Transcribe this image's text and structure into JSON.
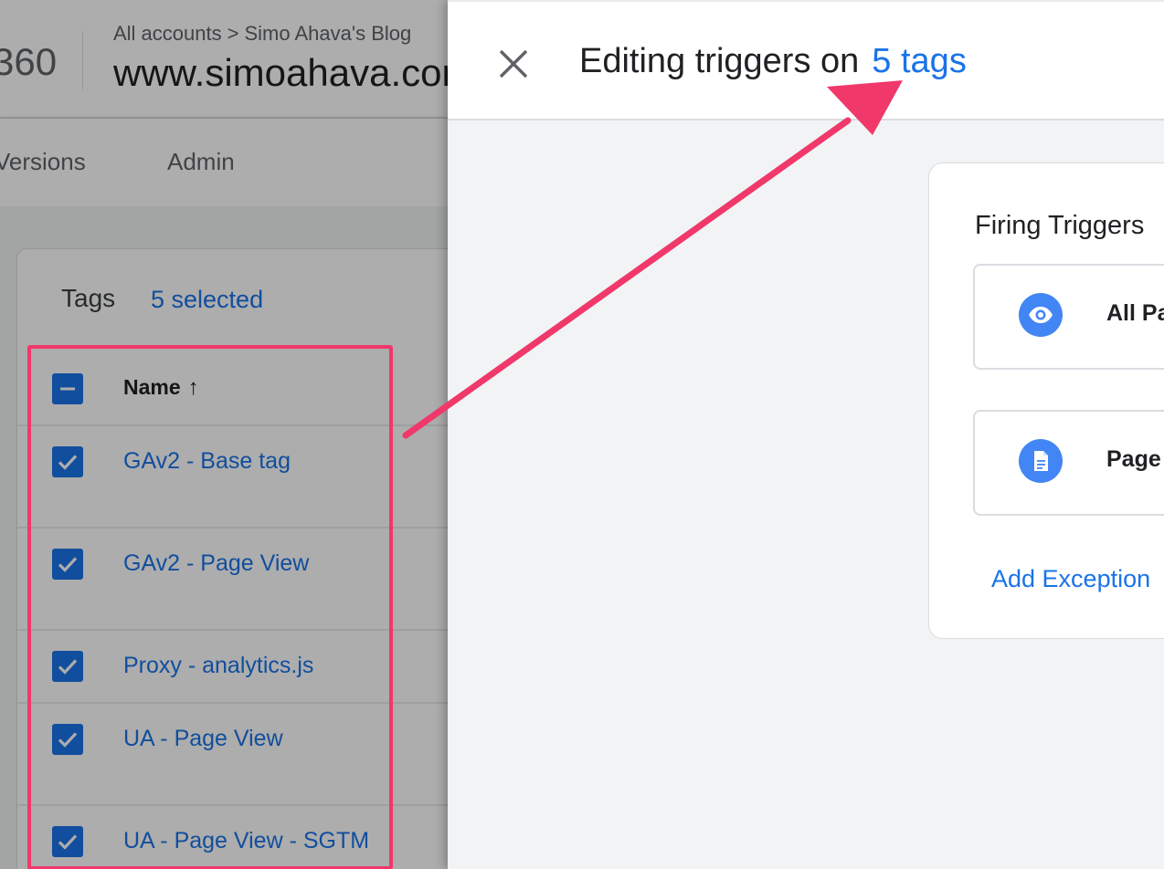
{
  "header": {
    "product_number": "360",
    "breadcrumb_accounts": "All accounts",
    "breadcrumb_chevron": ">",
    "breadcrumb_account": "Simo Ahava's Blog",
    "container_name": "www.simoahava.com"
  },
  "nav": {
    "versions_label": "Versions",
    "admin_label": "Admin"
  },
  "tags_card": {
    "title": "Tags",
    "selected_label": "5 selected",
    "column_name": "Name",
    "sort_arrow": "↑",
    "rows": [
      {
        "name": "GAv2 - Base tag"
      },
      {
        "name": "GAv2 - Page View"
      },
      {
        "name": "Proxy - analytics.js"
      },
      {
        "name": "UA - Page View"
      },
      {
        "name": "UA - Page View - SGTM"
      }
    ]
  },
  "panel": {
    "title_prefix": "Editing triggers on",
    "title_link": "5 tags",
    "close_icon": "close-icon",
    "firing_triggers_title": "Firing Triggers",
    "triggers": [
      {
        "label": "All Pages",
        "icon": "eye-icon"
      },
      {
        "label": "Page View",
        "icon": "document-icon"
      }
    ],
    "add_exception_label": "Add Exception"
  },
  "colors": {
    "accent": "#1a73e8",
    "highlight": "#f0386b",
    "trigger_icon_bg": "#4285f4"
  }
}
